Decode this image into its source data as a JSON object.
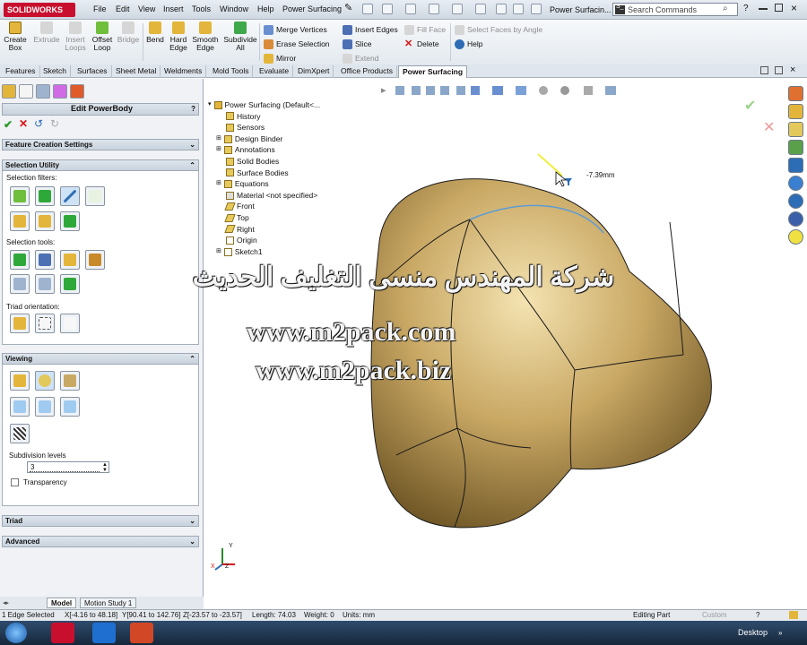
{
  "app": {
    "logo": "SOLIDWORKS",
    "doc_title": "Power Surfacin...",
    "search_placeholder": "Search Commands",
    "search_badge": "S_"
  },
  "menu": [
    "File",
    "Edit",
    "View",
    "Insert",
    "Tools",
    "Window",
    "Help",
    "Power Surfacing"
  ],
  "help_glyph": "?",
  "ribbon": {
    "big": [
      {
        "label": "Create\nBox",
        "enabled": true
      },
      {
        "label": "Extrude",
        "enabled": false
      },
      {
        "label": "Insert\nLoops",
        "enabled": false
      },
      {
        "label": "Offset\nLoop",
        "enabled": true
      },
      {
        "label": "Bridge",
        "enabled": false
      },
      {
        "label": "Bend",
        "enabled": true
      },
      {
        "label": "Hard\nEdge",
        "enabled": true
      },
      {
        "label": "Smooth\nEdge",
        "enabled": true
      },
      {
        "label": "Subdivide\nAll",
        "enabled": true
      }
    ],
    "col1": [
      {
        "label": "Merge Vertices",
        "enabled": true
      },
      {
        "label": "Erase Selection",
        "enabled": true
      },
      {
        "label": "Mirror",
        "enabled": true
      }
    ],
    "col2": [
      {
        "label": "Insert Edges",
        "enabled": true
      },
      {
        "label": "Slice",
        "enabled": true
      },
      {
        "label": "Extend",
        "enabled": false
      }
    ],
    "col3": [
      {
        "label": "Fill Face",
        "enabled": false
      },
      {
        "label": "Delete",
        "enabled": true
      }
    ],
    "col4": [
      {
        "label": "Select Faces by Angle",
        "enabled": false
      },
      {
        "label": "Help",
        "enabled": true
      }
    ]
  },
  "tabs": [
    "Features",
    "Sketch",
    "Surfaces",
    "Sheet Metal",
    "Weldments",
    "Mold Tools",
    "Evaluate",
    "DimXpert",
    "Office Products",
    "Power Surfacing"
  ],
  "active_tab": "Power Surfacing",
  "panel": {
    "title": "Edit PowerBody",
    "title_help": "?",
    "sections": {
      "feature_creation": "Feature Creation Settings",
      "selection_utility": "Selection Utility",
      "viewing": "Viewing",
      "triad": "Triad",
      "advanced": "Advanced"
    },
    "selection_filters_label": "Selection filters:",
    "selection_tools_label": "Selection tools:",
    "triad_orientation_label": "Triad orientation:",
    "subdivision_label": "Subdivision levels",
    "subdivision_value": "3",
    "transparency_label": "Transparency"
  },
  "tree": {
    "root": "Power Surfacing  (Default<...",
    "items": [
      "History",
      "Sensors",
      "Design Binder",
      "Annotations",
      "Solid Bodies",
      "Surface Bodies",
      "Equations",
      "Material <not specified>",
      "Front",
      "Top",
      "Right",
      "Origin",
      "Sketch1"
    ]
  },
  "viewport": {
    "dimension": "-7.39mm",
    "triad_x": "X",
    "triad_y": "Y",
    "triad_z": "Z"
  },
  "watermark": {
    "arabic": "شركة المهندس منسى التغليف الحديث",
    "url1": "www.m2pack.com",
    "url2": "www.m2pack.biz"
  },
  "bottom_tabs": [
    "Model",
    "Motion Study 1"
  ],
  "status": {
    "selected": "1 Edge Selected",
    "x": "X[-4.16 to 48.18]",
    "y": "Y[90.41 to 142.76]",
    "z": "Z[-23.57 to -23.57]",
    "length": "Length: 74.03",
    "weight": "Weight: 0",
    "units": "Units: mm",
    "mode": "Editing Part",
    "custom": "Custom",
    "help_glyph": "?"
  },
  "taskbar": {
    "desktop": "Desktop"
  },
  "colors": {
    "body": "#c9a864",
    "accent": "#2d6db5",
    "ribbon": "#e3e9ef"
  }
}
